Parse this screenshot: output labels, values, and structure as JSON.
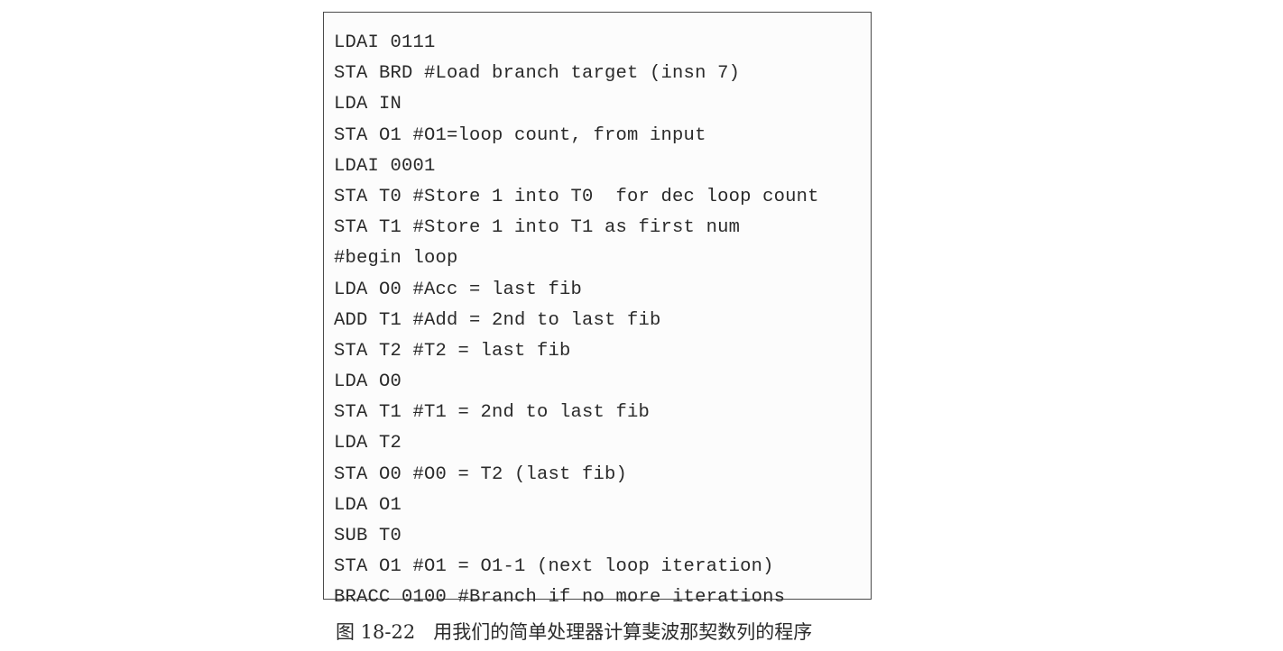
{
  "code_listing": {
    "lines": [
      "LDAI 0111",
      "STA BRD #Load branch target (insn 7)",
      "LDA IN",
      "STA O1 #O1=loop count, from input",
      "LDAI 0001",
      "STA T0 #Store 1 into T0  for dec loop count",
      "STA T1 #Store 1 into T1 as first num",
      "#begin loop",
      "LDA O0 #Acc = last fib",
      "ADD T1 #Add = 2nd to last fib",
      "STA T2 #T2 = last fib",
      "LDA O0",
      "STA T1 #T1 = 2nd to last fib",
      "LDA T2",
      "STA O0 #O0 = T2 (last fib)",
      "LDA O1",
      "SUB T0",
      "STA O1 #O1 = O1-1 (next loop iteration)",
      "BRACC 0100 #Branch if no more iterations"
    ]
  },
  "caption": "图 18-22   用我们的简单处理器计算斐波那契数列的程序"
}
